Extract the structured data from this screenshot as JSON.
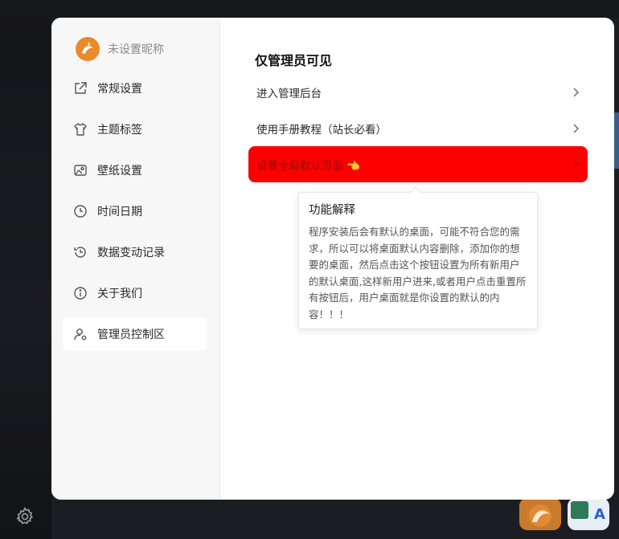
{
  "sidebar": {
    "profile_name": "未设置昵称",
    "items": [
      {
        "label": "常规设置",
        "icon": "external-link-icon"
      },
      {
        "label": "主题标签",
        "icon": "tshirt-icon"
      },
      {
        "label": "壁纸设置",
        "icon": "image-icon"
      },
      {
        "label": "时间日期",
        "icon": "clock-icon"
      },
      {
        "label": "数据变动记录",
        "icon": "history-icon"
      },
      {
        "label": "关于我们",
        "icon": "info-icon"
      },
      {
        "label": "管理员控制区",
        "icon": "user-settings-icon",
        "active": true
      }
    ]
  },
  "main": {
    "section_title": "仅管理员可见",
    "rows": [
      {
        "label": "进入管理后台"
      },
      {
        "label": "使用手册教程（站长必看）"
      },
      {
        "label": "设置全局默认页面 👈",
        "highlighted": true
      }
    ],
    "tooltip": {
      "title": "功能解释",
      "body": "程序安装后会有默认的桌面，可能不符合您的需求，所以可以将桌面默认内容删除，添加你的想要的桌面，然后点击这个按钮设置为所有新用户的默认桌面,这样新用户进来,或者用户点击重置所有按钮后，用户桌面就是你设置的默认的内容！！！"
    }
  },
  "colors": {
    "highlight": "#ff0000",
    "avatar": "#e98a2d",
    "sidebar_bg": "#f7f7f8"
  }
}
